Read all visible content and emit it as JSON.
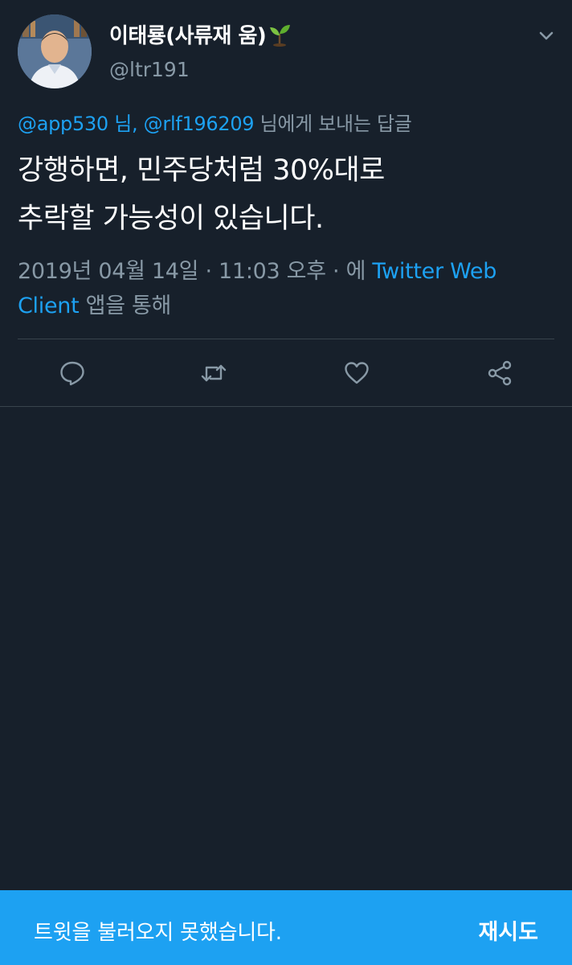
{
  "tweet": {
    "display_name": "이태룡(사류재 움)",
    "display_name_emoji": "sprout-icon",
    "handle": "@ltr191",
    "reply": {
      "mention1": "@app530 님,",
      "mention2": "@rlf196209",
      "suffix": " 님에게 보내는 답글"
    },
    "text_line1": "강행하면, 민주당처럼 30%대로",
    "text_line2": "추락할 가능성이 있습니다.",
    "timestamp": "2019년 04월 14일 · 11:03 오후 · 에 ",
    "source": "Twitter Web Client",
    "source_suffix": " 앱을 통해"
  },
  "actions": [
    {
      "icon": "reply-icon"
    },
    {
      "icon": "retweet-icon"
    },
    {
      "icon": "like-icon"
    },
    {
      "icon": "share-icon"
    }
  ],
  "snackbar": {
    "message": "트윗을 불러오지 못했습니다.",
    "action_label": "재시도"
  },
  "colors": {
    "background": "#17202b",
    "accent": "#1da1f2",
    "secondary_text": "#8899a6",
    "divider": "#38444d"
  }
}
